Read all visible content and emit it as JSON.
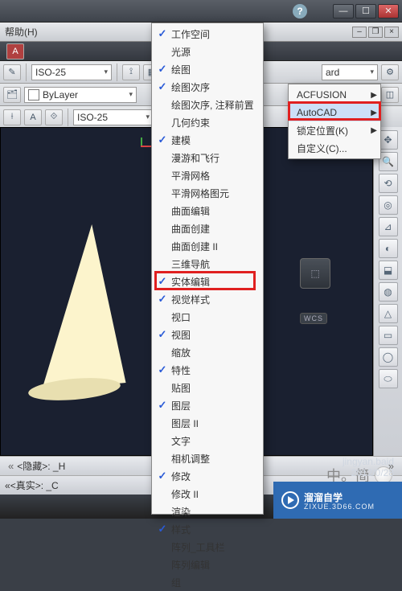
{
  "titlebar": {
    "help": "?"
  },
  "menubar": {
    "help_label": "帮助(H)"
  },
  "toolrow1": {
    "combo_iso": "ISO-25",
    "combo_layer": "ByLayer",
    "combo_right": "ard"
  },
  "toolrow3": {
    "combo_iso": "ISO-25"
  },
  "viewport": {
    "wcs_label": "WCS"
  },
  "status": {
    "hidden_label": "<隐藏>: _H",
    "real_label": "<真实>: _C"
  },
  "menu_items": [
    {
      "label": "工作空间",
      "checked": true
    },
    {
      "label": "光源",
      "checked": false
    },
    {
      "label": "绘图",
      "checked": true
    },
    {
      "label": "绘图次序",
      "checked": true
    },
    {
      "label": "绘图次序, 注释前置",
      "checked": false
    },
    {
      "label": "几何约束",
      "checked": false
    },
    {
      "label": "建模",
      "checked": true
    },
    {
      "label": "漫游和飞行",
      "checked": false
    },
    {
      "label": "平滑网格",
      "checked": false
    },
    {
      "label": "平滑网格图元",
      "checked": false
    },
    {
      "label": "曲面编辑",
      "checked": false
    },
    {
      "label": "曲面创建",
      "checked": false
    },
    {
      "label": "曲面创建 II",
      "checked": false
    },
    {
      "label": "三维导航",
      "checked": false
    },
    {
      "label": "实体编辑",
      "checked": true
    },
    {
      "label": "视觉样式",
      "checked": true
    },
    {
      "label": "视口",
      "checked": false
    },
    {
      "label": "视图",
      "checked": true
    },
    {
      "label": "缩放",
      "checked": false
    },
    {
      "label": "特性",
      "checked": true
    },
    {
      "label": "贴图",
      "checked": false
    },
    {
      "label": "图层",
      "checked": true
    },
    {
      "label": "图层 II",
      "checked": false
    },
    {
      "label": "文字",
      "checked": false
    },
    {
      "label": "相机调整",
      "checked": false
    },
    {
      "label": "修改",
      "checked": true
    },
    {
      "label": "修改 II",
      "checked": false
    },
    {
      "label": "渲染",
      "checked": false
    },
    {
      "label": "样式",
      "checked": true
    },
    {
      "label": "阵列_工具栏",
      "checked": false
    },
    {
      "label": "阵列编辑",
      "checked": false
    },
    {
      "label": "组",
      "checked": false
    }
  ],
  "submenu": [
    {
      "label": "ACFUSION",
      "hover": false
    },
    {
      "label": "AutoCAD",
      "hover": true
    },
    {
      "label": "锁定位置(K)",
      "hover": false
    },
    {
      "label": "自定义(C)...",
      "hover": false
    }
  ],
  "watermark": {
    "text": "中。简"
  },
  "brand": {
    "title": "溜溜自学",
    "sub": "ZIXUE.3D66.COM"
  },
  "user": {
    "name": "jingyan.baid",
    "date": "2012/0/28"
  }
}
